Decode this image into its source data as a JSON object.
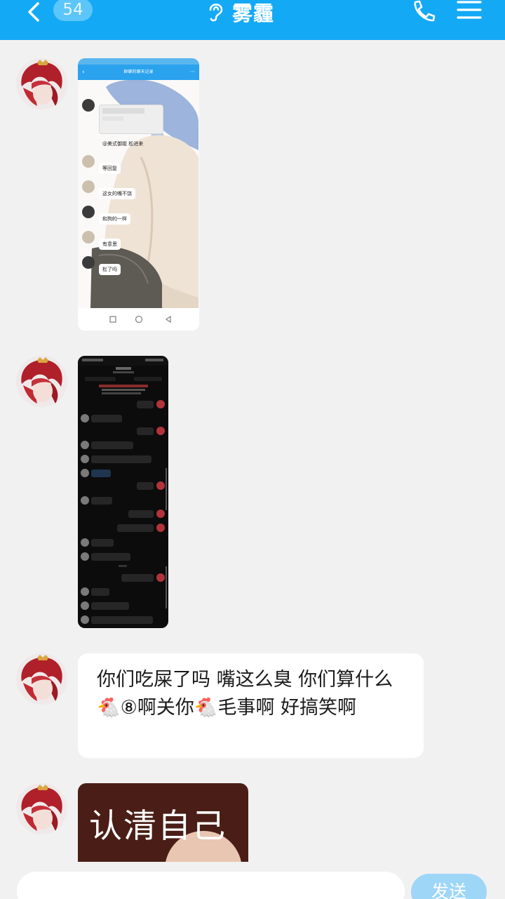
{
  "header": {
    "back_icon": "chevron-left-icon",
    "unread_count": "54",
    "ear_icon": "ear-icon",
    "title": "雾霾",
    "call_icon": "phone-icon",
    "menu_icon": "menu-icon",
    "color": "#14a9f5"
  },
  "messages": [
    {
      "type": "image",
      "description_icon": "chat-screenshot-image",
      "inner": {
        "title": "群聊的聊天记录",
        "rows": [
          "等回复",
          "这女的嘴不饶",
          "和狗的一样",
          "有意思",
          "松了吗"
        ],
        "mention": "@美式御姐 松进来"
      }
    },
    {
      "type": "image",
      "description_icon": "dark-chat-screenshot-image"
    },
    {
      "type": "text",
      "text": "你们吃屎了吗 嘴这么臭 你们算什么🐔⑧啊关你🐔毛事啊 好搞笑啊"
    },
    {
      "type": "image",
      "sticker_text": "认清自己"
    }
  ],
  "input": {
    "value": "",
    "send_label": "发送"
  }
}
